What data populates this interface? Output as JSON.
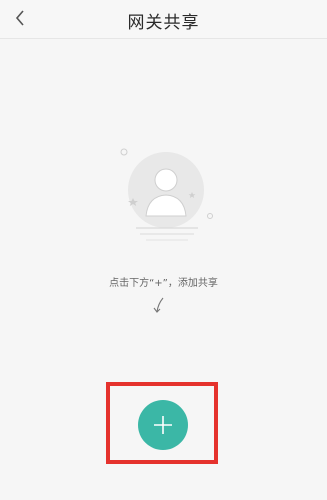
{
  "header": {
    "title": "网关共享",
    "back_icon": "chevron-left-icon"
  },
  "empty_state": {
    "illustration_icon": "user-placeholder-icon",
    "hint": "点击下方“+”，添加共享",
    "arrow_icon": "curved-down-arrow-icon"
  },
  "add_button": {
    "icon": "plus-icon",
    "color": "#3bb7a6"
  },
  "highlight": {
    "color": "#e5322d"
  }
}
